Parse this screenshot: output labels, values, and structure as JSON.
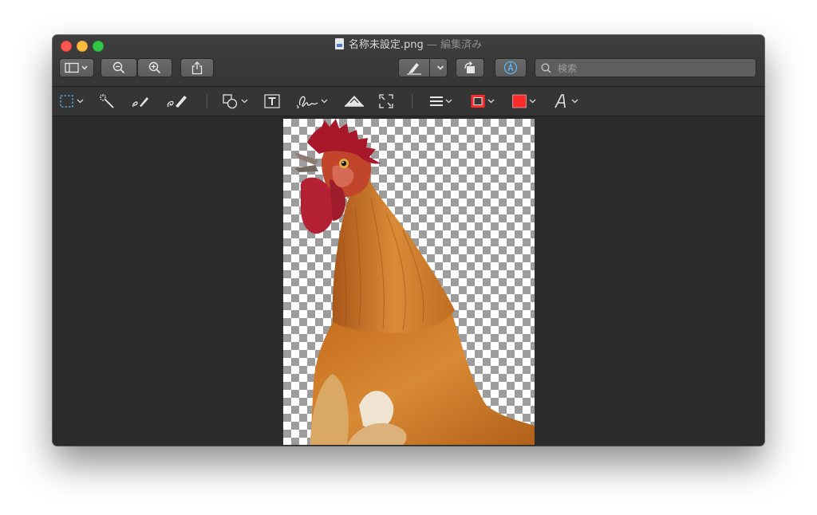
{
  "window": {
    "filename": "名称未設定.png",
    "status": "— 編集済み"
  },
  "toolbar": {
    "search_placeholder": "検索",
    "accent_color": "#5ab4f0"
  },
  "markup_toolbar": {
    "tools": [
      "rectangular-selection-icon",
      "instant-alpha-icon",
      "sketch-icon",
      "draw-icon",
      "shapes-icon",
      "text-box-icon",
      "signature-icon",
      "adjust-color-icon",
      "adjust-size-icon",
      "line-style-icon",
      "border-color-icon",
      "fill-color-icon",
      "text-style-icon"
    ],
    "border_color": "#ff2a2a",
    "fill_color": "#ff2a2a"
  }
}
